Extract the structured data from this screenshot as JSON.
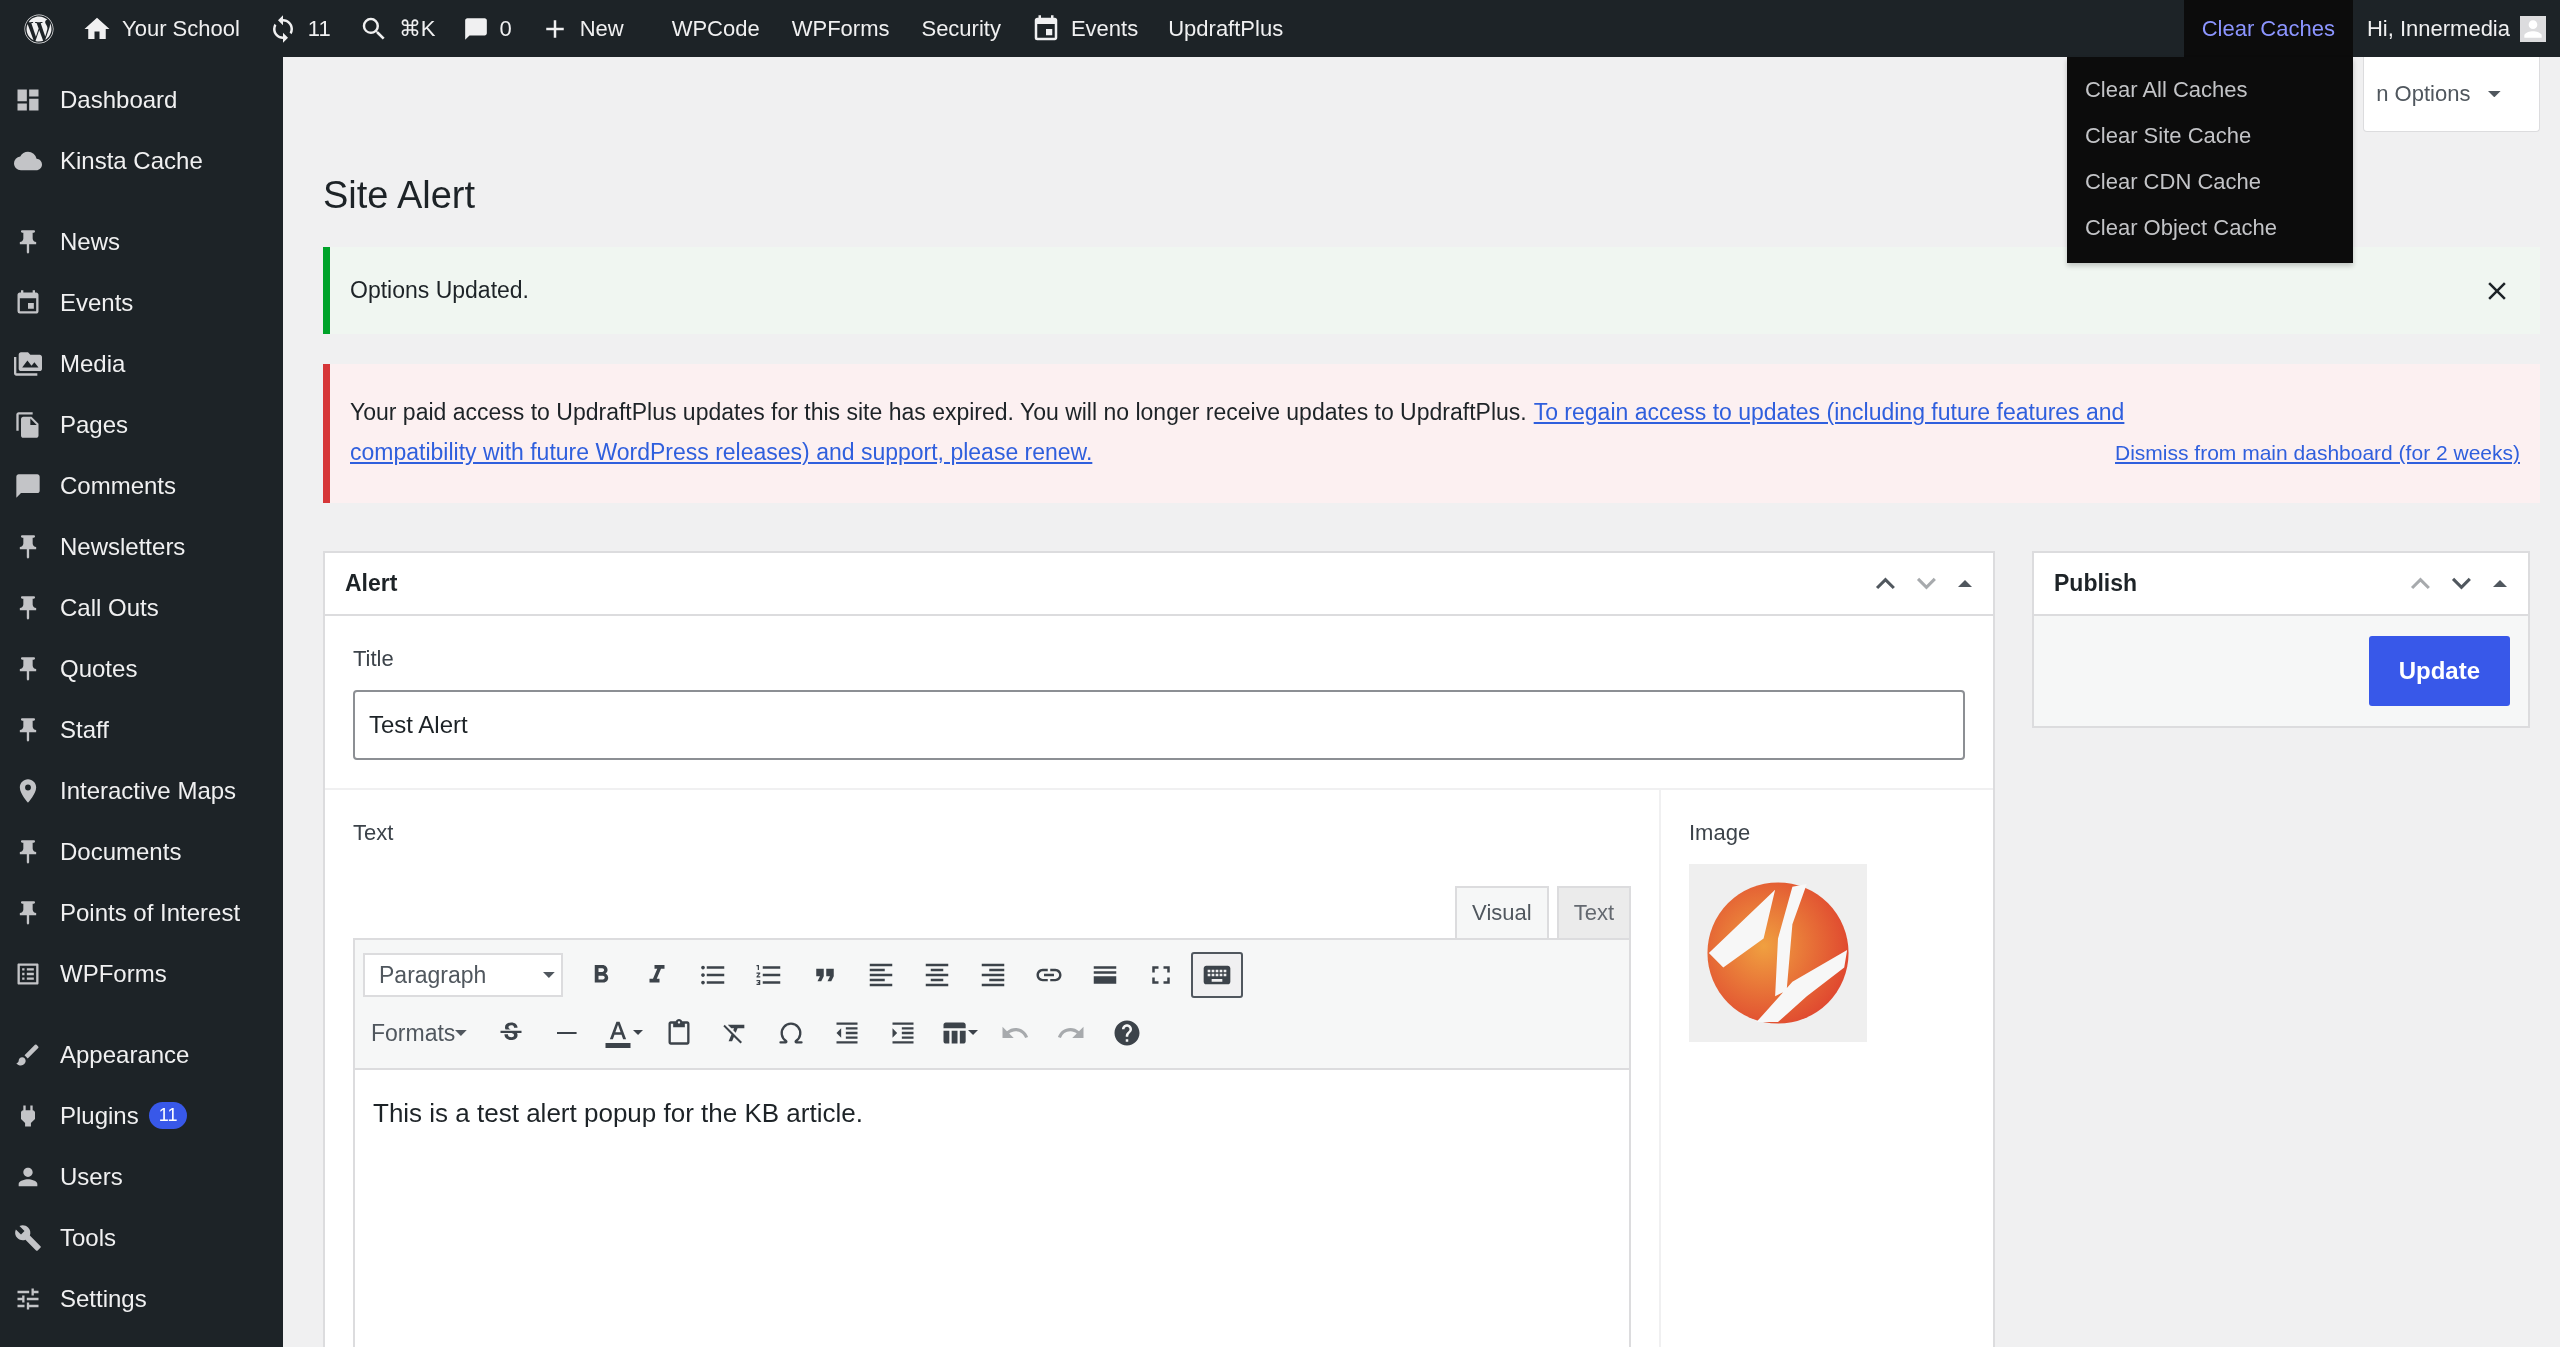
{
  "admin_bar": {
    "site_name": "Your School",
    "updates_count": "11",
    "search_shortcut": "⌘K",
    "comments_count": "0",
    "new_label": "New",
    "plugin_links": [
      {
        "label": "WPCode",
        "kind": "text"
      },
      {
        "label": "WPForms",
        "kind": "text"
      },
      {
        "label": "Security",
        "kind": "text"
      },
      {
        "label": "Events",
        "kind": "calendar"
      },
      {
        "label": "UpdraftPlus",
        "kind": "text"
      }
    ],
    "cache_menu": {
      "label": "Clear Caches",
      "expanded": true,
      "items": [
        "Clear All Caches",
        "Clear Site Cache",
        "Clear CDN Cache",
        "Clear Object Cache"
      ]
    },
    "greeting": "Hi, Innermedia"
  },
  "sidebar": {
    "groups": [
      [
        {
          "label": "Dashboard"
        },
        {
          "label": "Kinsta Cache"
        }
      ],
      [
        {
          "label": "News"
        },
        {
          "label": "Events"
        },
        {
          "label": "Media"
        },
        {
          "label": "Pages"
        },
        {
          "label": "Comments"
        },
        {
          "label": "Newsletters"
        },
        {
          "label": "Call Outs"
        },
        {
          "label": "Quotes"
        },
        {
          "label": "Staff"
        },
        {
          "label": "Interactive Maps"
        },
        {
          "label": "Documents"
        },
        {
          "label": "Points of Interest"
        },
        {
          "label": "WPForms"
        }
      ],
      [
        {
          "label": "Appearance"
        },
        {
          "label": "Plugins",
          "badge": "11"
        },
        {
          "label": "Users"
        },
        {
          "label": "Tools"
        },
        {
          "label": "Settings"
        }
      ]
    ]
  },
  "screen_options": "n Options",
  "page_title": "Site Alert",
  "success_notice": {
    "text": "Options Updated."
  },
  "error_notice": {
    "text": "Your paid access to UpdraftPlus updates for this site has expired. You will no longer receive updates to UpdraftPlus.",
    "link_lines": [
      "To regain access to updates (including future features and",
      "compatibility with future WordPress releases) and support, please renew."
    ],
    "dismiss": "Dismiss from main dashboard (for 2 weeks)"
  },
  "alert_box": {
    "title": "Alert",
    "move_up_disabled": false,
    "move_down_disabled": true,
    "title_field": {
      "label": "Title",
      "value": "Test Alert"
    },
    "text_field": {
      "label": "Text",
      "tabs": [
        {
          "label": "Visual",
          "selected": true
        },
        {
          "label": "Text",
          "selected": false
        }
      ],
      "format_select": "Paragraph",
      "formats_menu": "Formats",
      "toolbar_toggle_on": true,
      "undo_disabled": true,
      "redo_disabled": true,
      "content": "This is a test alert popup for the KB article."
    },
    "image_field": {
      "label": "Image"
    }
  },
  "publish_box": {
    "title": "Publish",
    "move_up_disabled": true,
    "move_down_disabled": false,
    "button": "Update"
  }
}
